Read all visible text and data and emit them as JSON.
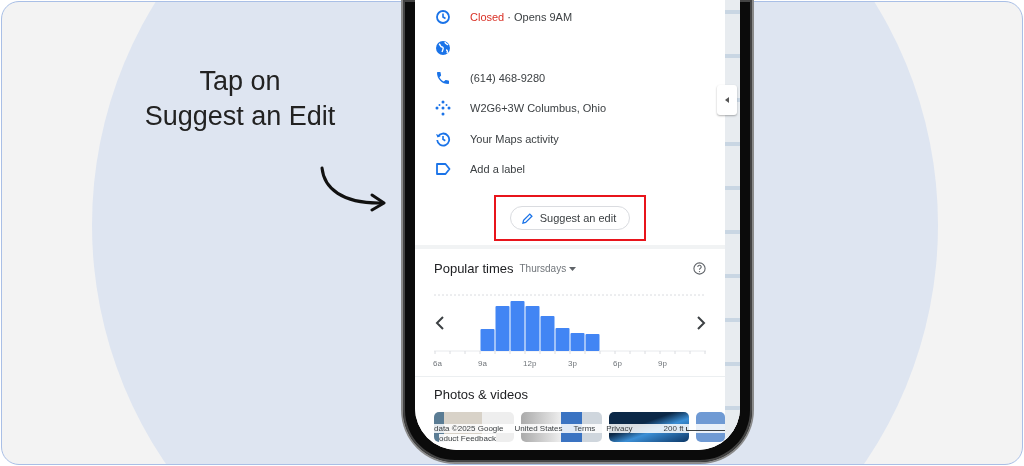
{
  "callout": {
    "lines": [
      "Tap on",
      "Suggest an Edit"
    ]
  },
  "place_details": [
    {
      "kind": "hours",
      "status": "Closed",
      "text": "· Opens 9AM"
    },
    {
      "kind": "website"
    },
    {
      "kind": "phone",
      "text": "(614) 468-9280"
    },
    {
      "kind": "pluscode",
      "text": "W2G6+3W Columbus, Ohio"
    },
    {
      "kind": "activity",
      "text": "Your Maps activity"
    },
    {
      "kind": "label",
      "text": "Add a label"
    }
  ],
  "suggest_edit_button": {
    "label": "Suggest an edit",
    "highlighted": true
  },
  "popular_times": {
    "title": "Popular times",
    "day": "Thursdays",
    "x_labels": [
      "6a",
      "9a",
      "12p",
      "3p",
      "6p",
      "9p"
    ]
  },
  "photos": {
    "title": "Photos & videos"
  },
  "map_footer": {
    "items": [
      "data ©2025 Google",
      "United States",
      "Terms",
      "Privacy"
    ],
    "scale": "200 ft",
    "feedback": "oduct Feedback"
  }
}
